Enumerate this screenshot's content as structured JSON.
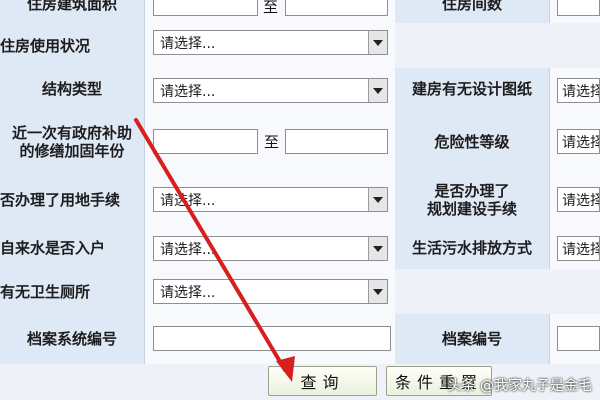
{
  "form": {
    "rows": [
      {
        "left_label": "住房建筑面积",
        "right_label": "至",
        "right2_label": "住房间数"
      },
      {
        "left_label": "住房使用状况",
        "left_select": "请选择..."
      },
      {
        "left_label": "结构类型",
        "left_select": "请选择...",
        "right_label": "建房有无设计图纸",
        "right_select": "请选择..."
      },
      {
        "left_label_lines": [
          "近一次有政府补助",
          "的修缮加固年份"
        ],
        "to_label": "至",
        "right_label": "危险性等级",
        "right_select": "请选择..."
      },
      {
        "left_label": "否办理了用地手续",
        "left_select": "请选择...",
        "right_label_lines": [
          "是否办理了",
          "规划建设手续"
        ],
        "right_select": "请选择..."
      },
      {
        "left_label": "自来水是否入户",
        "left_select": "请选择...",
        "right_label": "生活污水排放方式",
        "right_select": "请选择..."
      },
      {
        "left_label": "有无卫生厕所",
        "left_select": "请选择..."
      },
      {
        "left_label": "档案系统编号",
        "right_label": "档案编号"
      }
    ],
    "buttons": {
      "query": "查询",
      "condition": "条件重置"
    }
  },
  "watermark": "头条 @我家丸子是金毛",
  "colors": {
    "arrow": "#d81f1f",
    "label_bg": "#dfe8f5",
    "value_bg": "#f7f9fc",
    "button_bg": "#eef3e4"
  }
}
